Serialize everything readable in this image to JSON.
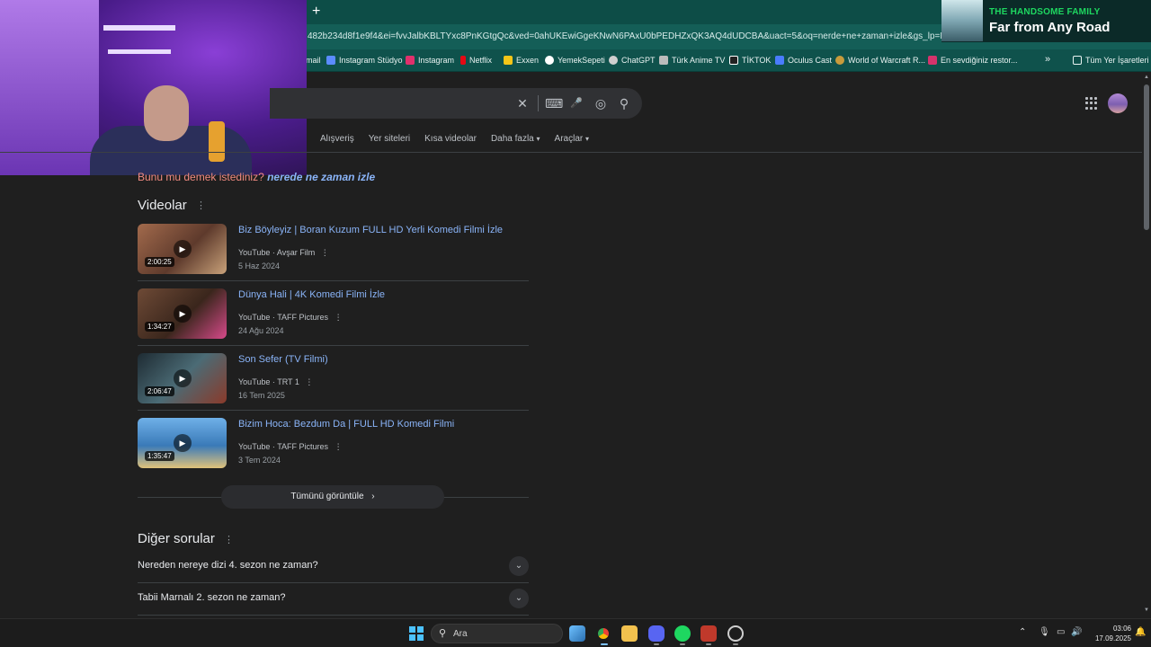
{
  "browser": {
    "new_tab_symbol": "+",
    "url": "482b234d8f1e9f4&ei=fvvJalbKBLTYxc8PnKGtgQc&ved=0ahUKEwiGgeKNwN6PAxU0bPEDHZxQK3AQ4dUDCBA&uact=5&oq=nerde+ne+zaman+izle&gs_lp=Egxnd3Mtd2l6",
    "bookmarks": [
      {
        "label": "mail",
        "color": "#ea4335"
      },
      {
        "label": "Instagram Stüdyo",
        "color": "#5b8cff"
      },
      {
        "label": "Instagram",
        "color": "#e1306c"
      },
      {
        "label": "Netflix",
        "color": "#e50914"
      },
      {
        "label": "Exxen",
        "color": "#f5c518"
      },
      {
        "label": "YemekSepeti",
        "color": "#ffffff"
      },
      {
        "label": "ChatGPT",
        "color": "#cfcfcf"
      },
      {
        "label": "Türk Anime TV",
        "color": "#bbbbbb"
      },
      {
        "label": "TİKTOK",
        "color": "#222222"
      },
      {
        "label": "Oculus Cast",
        "color": "#4a7cff"
      },
      {
        "label": "World of Warcraft R...",
        "color": "#c89b3c"
      },
      {
        "label": "En sevdiğiniz restor...",
        "color": "#d6336c"
      }
    ],
    "more_symbol": "»",
    "all_bookmarks": "Tüm Yer İşaretleri"
  },
  "spotify": {
    "artist": "THE HANDSOME FAMILY",
    "title": "Far from Any Road"
  },
  "search": {
    "clear": "✕",
    "keyboard": "⌨",
    "mic": "🎤",
    "lens": "◎",
    "search": "⚲"
  },
  "filters": [
    "Alışveriş",
    "Yer siteleri",
    "Kısa videolar",
    "Daha fazla",
    "Araçlar"
  ],
  "did_you_mean": {
    "prefix": "Bunu mu demek istediniz? ",
    "bold": "nerede",
    "rest": " ne zaman izle"
  },
  "videos_section": {
    "title": "Videolar",
    "items": [
      {
        "title": "Biz Böyleyiz | Boran Kuzum FULL HD Yerli Komedi Filmi İzle",
        "source": "YouTube · Avşar Film",
        "date": "5 Haz 2024",
        "duration": "2:00:25",
        "thumb": "#7a4a38"
      },
      {
        "title": "Dünya Hali | 4K Komedi Filmi İzle",
        "source": "YouTube · TAFF Pictures",
        "date": "24 Ağu 2024",
        "duration": "1:34:27",
        "thumb": "#5a3a2a"
      },
      {
        "title": "Son Sefer (TV Filmi)",
        "source": "YouTube · TRT 1",
        "date": "16 Tem 2025",
        "duration": "2:06:47",
        "thumb": "#2e4a55"
      },
      {
        "title": "Bizim Hoca: Bezdum Da | FULL HD Komedi Filmi",
        "source": "YouTube · TAFF Pictures",
        "date": "3 Tem 2024",
        "duration": "1:35:47",
        "thumb": "#3a7ab8"
      }
    ],
    "see_all": "Tümünü görüntüle"
  },
  "questions_section": {
    "title": "Diğer sorular",
    "items": [
      "Nereden nereye dizi 4. sezon ne zaman?",
      "Tabii Marnalı 2. sezon ne zaman?"
    ]
  },
  "taskbar": {
    "search_placeholder": "Ara",
    "time": "03:06",
    "date": "17.09.2025"
  }
}
